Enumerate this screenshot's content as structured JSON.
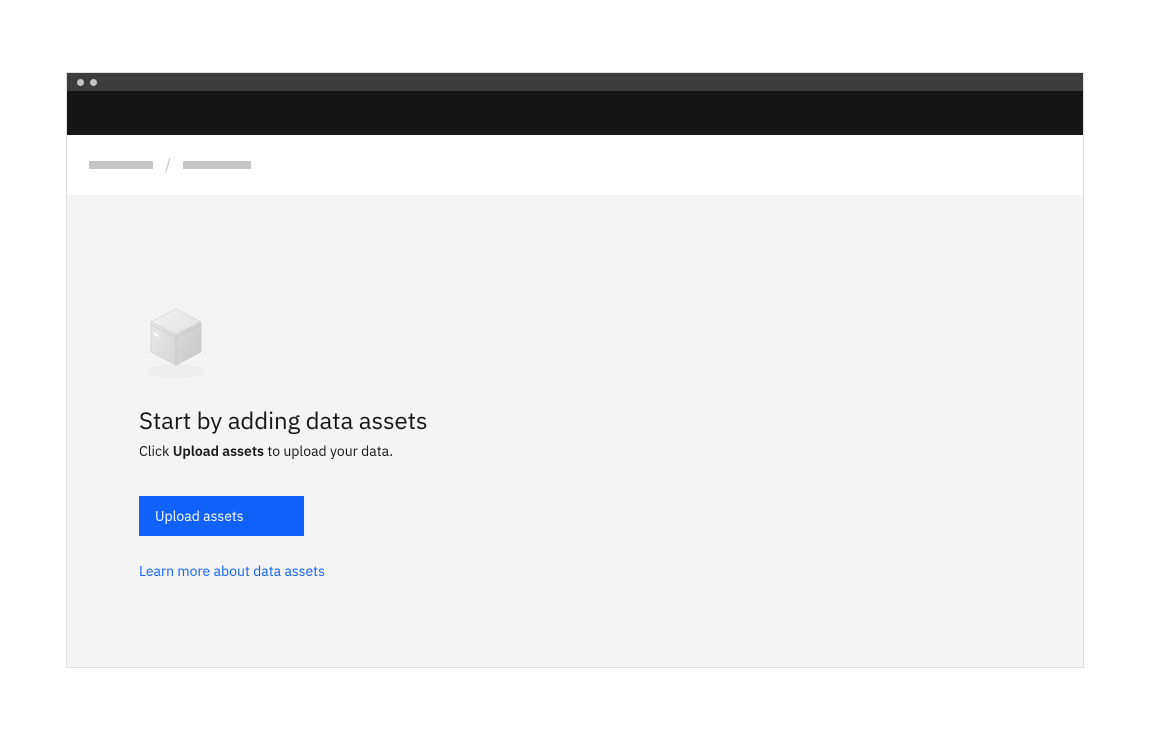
{
  "emptyState": {
    "heading": "Start by adding data assets",
    "subtextPrefix": "Click ",
    "subtextBold": "Upload assets",
    "subtextSuffix": " to upload your data.",
    "primaryButton": "Upload assets",
    "learnMoreLink": "Learn more about data assets"
  },
  "colors": {
    "primary": "#0f62fe",
    "headerBg": "#161616",
    "titlebarBg": "#3d3d3d",
    "contentBg": "#f4f4f4",
    "placeholder": "#c6c6c6"
  }
}
